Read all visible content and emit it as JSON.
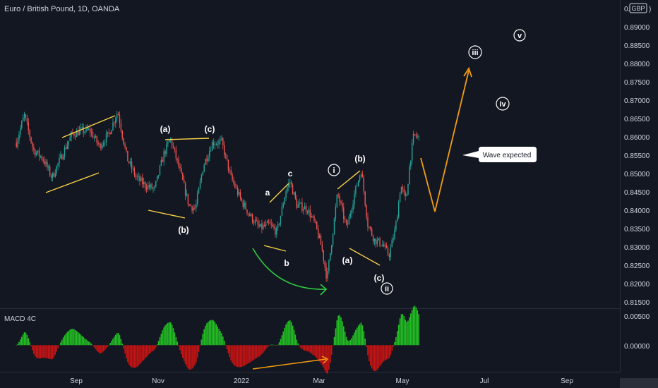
{
  "header": {
    "symbol_title": "Euro / British Pound, 1D, OANDA"
  },
  "price_axis": {
    "currency_badge": "GBP",
    "top_partial": "0.",
    "top_partial_right": ")",
    "labels": [
      "0.89000",
      "0.88500",
      "0.88000",
      "0.87500",
      "0.87000",
      "0.86500",
      "0.86000",
      "0.85500",
      "0.85000",
      "0.84500",
      "0.84000",
      "0.83500",
      "0.83000",
      "0.82500",
      "0.82000",
      "0.81500"
    ]
  },
  "macd_panel": {
    "title": "MACD 4C",
    "labels": [
      "0.00500",
      "0.00000"
    ]
  },
  "time_axis": {
    "labels": [
      "Sep",
      "Nov",
      "2022",
      "Mar",
      "May",
      "Jul",
      "Sep"
    ]
  },
  "annotations": {
    "a_pair": [
      "(a)",
      "(c)",
      "(b)"
    ],
    "abc": [
      "a",
      "c",
      "b"
    ],
    "wave_i": "i",
    "wave_b": "(b)",
    "wave_a": "(a)",
    "wave_c": "(c)",
    "wave_ii": "ii",
    "wave_iii": "iii",
    "wave_iv": "iv",
    "wave_v": "v",
    "callout": "Wave expected"
  },
  "colors": {
    "background": "#131722",
    "up_candle": "#26a69a",
    "down_candle": "#ef5350",
    "macd_up": "#22c022",
    "macd_down": "#c81414",
    "wave_lines": "#f7d046",
    "projection": "#f39c12",
    "curve_arrow": "#2ecc40",
    "divergence": "#f39c12"
  },
  "chart_data": {
    "type": "candlestick",
    "symbol": "Euro / British Pound",
    "interval": "1D",
    "source": "OANDA",
    "ylim": [
      0.8135,
      0.8925
    ],
    "close_path": [
      {
        "t": "2021-07-14",
        "v": 0.856
      },
      {
        "t": "2021-07-20",
        "v": 0.863
      },
      {
        "t": "2021-07-27",
        "v": 0.854
      },
      {
        "t": "2021-08-03",
        "v": 0.852
      },
      {
        "t": "2021-08-10",
        "v": 0.847
      },
      {
        "t": "2021-08-18",
        "v": 0.853
      },
      {
        "t": "2021-08-25",
        "v": 0.858
      },
      {
        "t": "2021-09-01",
        "v": 0.859
      },
      {
        "t": "2021-09-08",
        "v": 0.859
      },
      {
        "t": "2021-09-15",
        "v": 0.855
      },
      {
        "t": "2021-09-22",
        "v": 0.858
      },
      {
        "t": "2021-09-29",
        "v": 0.864
      },
      {
        "t": "2021-10-06",
        "v": 0.852
      },
      {
        "t": "2021-10-13",
        "v": 0.847
      },
      {
        "t": "2021-10-20",
        "v": 0.845
      },
      {
        "t": "2021-10-27",
        "v": 0.844
      },
      {
        "t": "2021-11-03",
        "v": 0.853
      },
      {
        "t": "2021-11-08",
        "v": 0.857
      },
      {
        "t": "2021-11-15",
        "v": 0.849
      },
      {
        "t": "2021-11-22",
        "v": 0.84
      },
      {
        "t": "2021-11-27",
        "v": 0.839
      },
      {
        "t": "2021-12-03",
        "v": 0.85
      },
      {
        "t": "2021-12-10",
        "v": 0.856
      },
      {
        "t": "2021-12-17",
        "v": 0.856
      },
      {
        "t": "2021-12-24",
        "v": 0.847
      },
      {
        "t": "2022-01-01",
        "v": 0.841
      },
      {
        "t": "2022-01-08",
        "v": 0.837
      },
      {
        "t": "2022-01-15",
        "v": 0.834
      },
      {
        "t": "2022-01-22",
        "v": 0.835
      },
      {
        "t": "2022-01-28",
        "v": 0.833
      },
      {
        "t": "2022-02-04",
        "v": 0.844
      },
      {
        "t": "2022-02-07",
        "v": 0.846
      },
      {
        "t": "2022-02-12",
        "v": 0.84
      },
      {
        "t": "2022-02-20",
        "v": 0.839
      },
      {
        "t": "2022-02-26",
        "v": 0.835
      },
      {
        "t": "2022-03-03",
        "v": 0.829
      },
      {
        "t": "2022-03-07",
        "v": 0.821
      },
      {
        "t": "2022-03-15",
        "v": 0.843
      },
      {
        "t": "2022-03-22",
        "v": 0.834
      },
      {
        "t": "2022-03-28",
        "v": 0.843
      },
      {
        "t": "2022-04-02",
        "v": 0.849
      },
      {
        "t": "2022-04-07",
        "v": 0.835
      },
      {
        "t": "2022-04-12",
        "v": 0.831
      },
      {
        "t": "2022-04-18",
        "v": 0.83
      },
      {
        "t": "2022-04-23",
        "v": 0.827
      },
      {
        "t": "2022-04-28",
        "v": 0.834
      },
      {
        "t": "2022-05-02",
        "v": 0.845
      },
      {
        "t": "2022-05-06",
        "v": 0.841
      },
      {
        "t": "2022-05-09",
        "v": 0.851
      },
      {
        "t": "2022-05-12",
        "v": 0.858
      },
      {
        "t": "2022-05-16",
        "v": 0.857
      }
    ],
    "projection_path": [
      {
        "t": "2022-05-17",
        "v": 0.855
      },
      {
        "t": "2022-06-05",
        "v": 0.84
      },
      {
        "t": "2022-07-01",
        "v": 0.879
      }
    ],
    "wave_labels": [
      {
        "label": "(a)",
        "t": "2021-11-03",
        "v": 0.8625
      },
      {
        "label": "(c)",
        "t": "2021-12-10",
        "v": 0.8627
      },
      {
        "label": "(b)",
        "t": "2021-11-25",
        "v": 0.8345
      },
      {
        "label": "a",
        "t": "2022-02-01",
        "v": 0.844
      },
      {
        "label": "c",
        "t": "2022-02-15",
        "v": 0.8495
      },
      {
        "label": "b",
        "t": "2022-02-15",
        "v": 0.8278
      },
      {
        "label": "i",
        "t": "2022-03-29",
        "v": 0.8508
      },
      {
        "label": "(b)",
        "t": "2022-04-17",
        "v": 0.8538
      },
      {
        "label": "(a)",
        "t": "2022-04-08",
        "v": 0.8282
      },
      {
        "label": "(c)",
        "t": "2022-04-27",
        "v": 0.822
      },
      {
        "label": "ii",
        "t": "2022-04-30",
        "v": 0.8195
      },
      {
        "label": "iii",
        "t": "2022-06-29",
        "v": 0.883
      },
      {
        "label": "iv",
        "t": "2022-07-23",
        "v": 0.8695
      },
      {
        "label": "v",
        "t": "2022-08-15",
        "v": 0.888
      }
    ],
    "macd": {
      "ylim": [
        -0.00625,
        0.0085
      ]
    }
  }
}
